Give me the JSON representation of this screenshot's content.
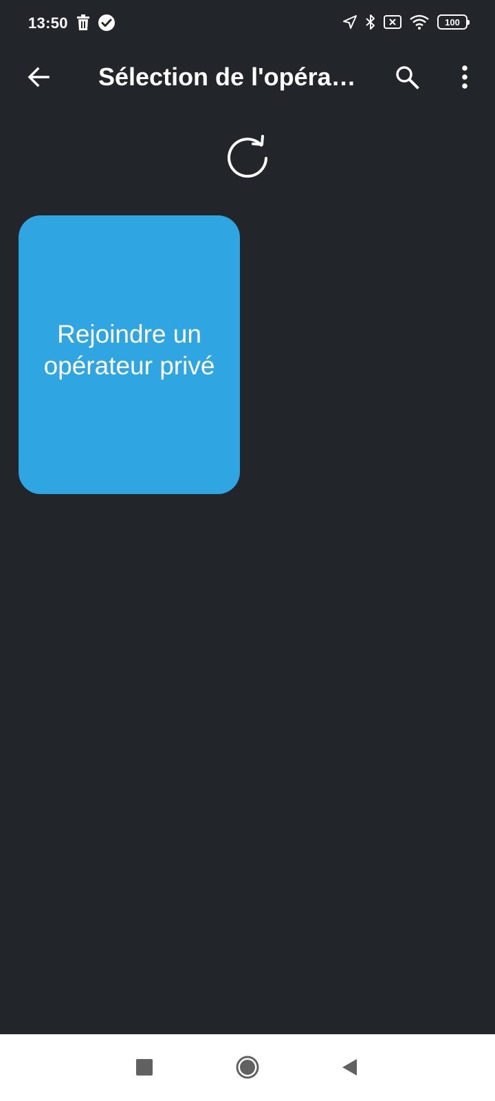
{
  "status_bar": {
    "time": "13:50",
    "battery_level": "100",
    "icons_left": [
      "trash-icon",
      "check-circle-icon"
    ],
    "icons_right": [
      "navigation-arrow-icon",
      "bluetooth-icon",
      "no-sim-icon",
      "wifi-icon",
      "battery-icon"
    ]
  },
  "app_bar": {
    "title": "Sélection de l'opérateur",
    "back_icon": "arrow-back-icon",
    "search_icon": "search-icon",
    "more_icon": "more-vertical-icon"
  },
  "main": {
    "refresh_icon": "refresh-icon",
    "cards": [
      {
        "label": "Rejoindre un opérateur privé"
      }
    ]
  },
  "nav_bar": {
    "icons": [
      "recents-square-icon",
      "home-circle-icon",
      "back-triangle-icon"
    ]
  },
  "colors": {
    "background": "#22252a",
    "card": "#2fa5e1",
    "text": "#ffffff",
    "nav_bar": "#ffffff",
    "nav_icons": "#616161"
  }
}
